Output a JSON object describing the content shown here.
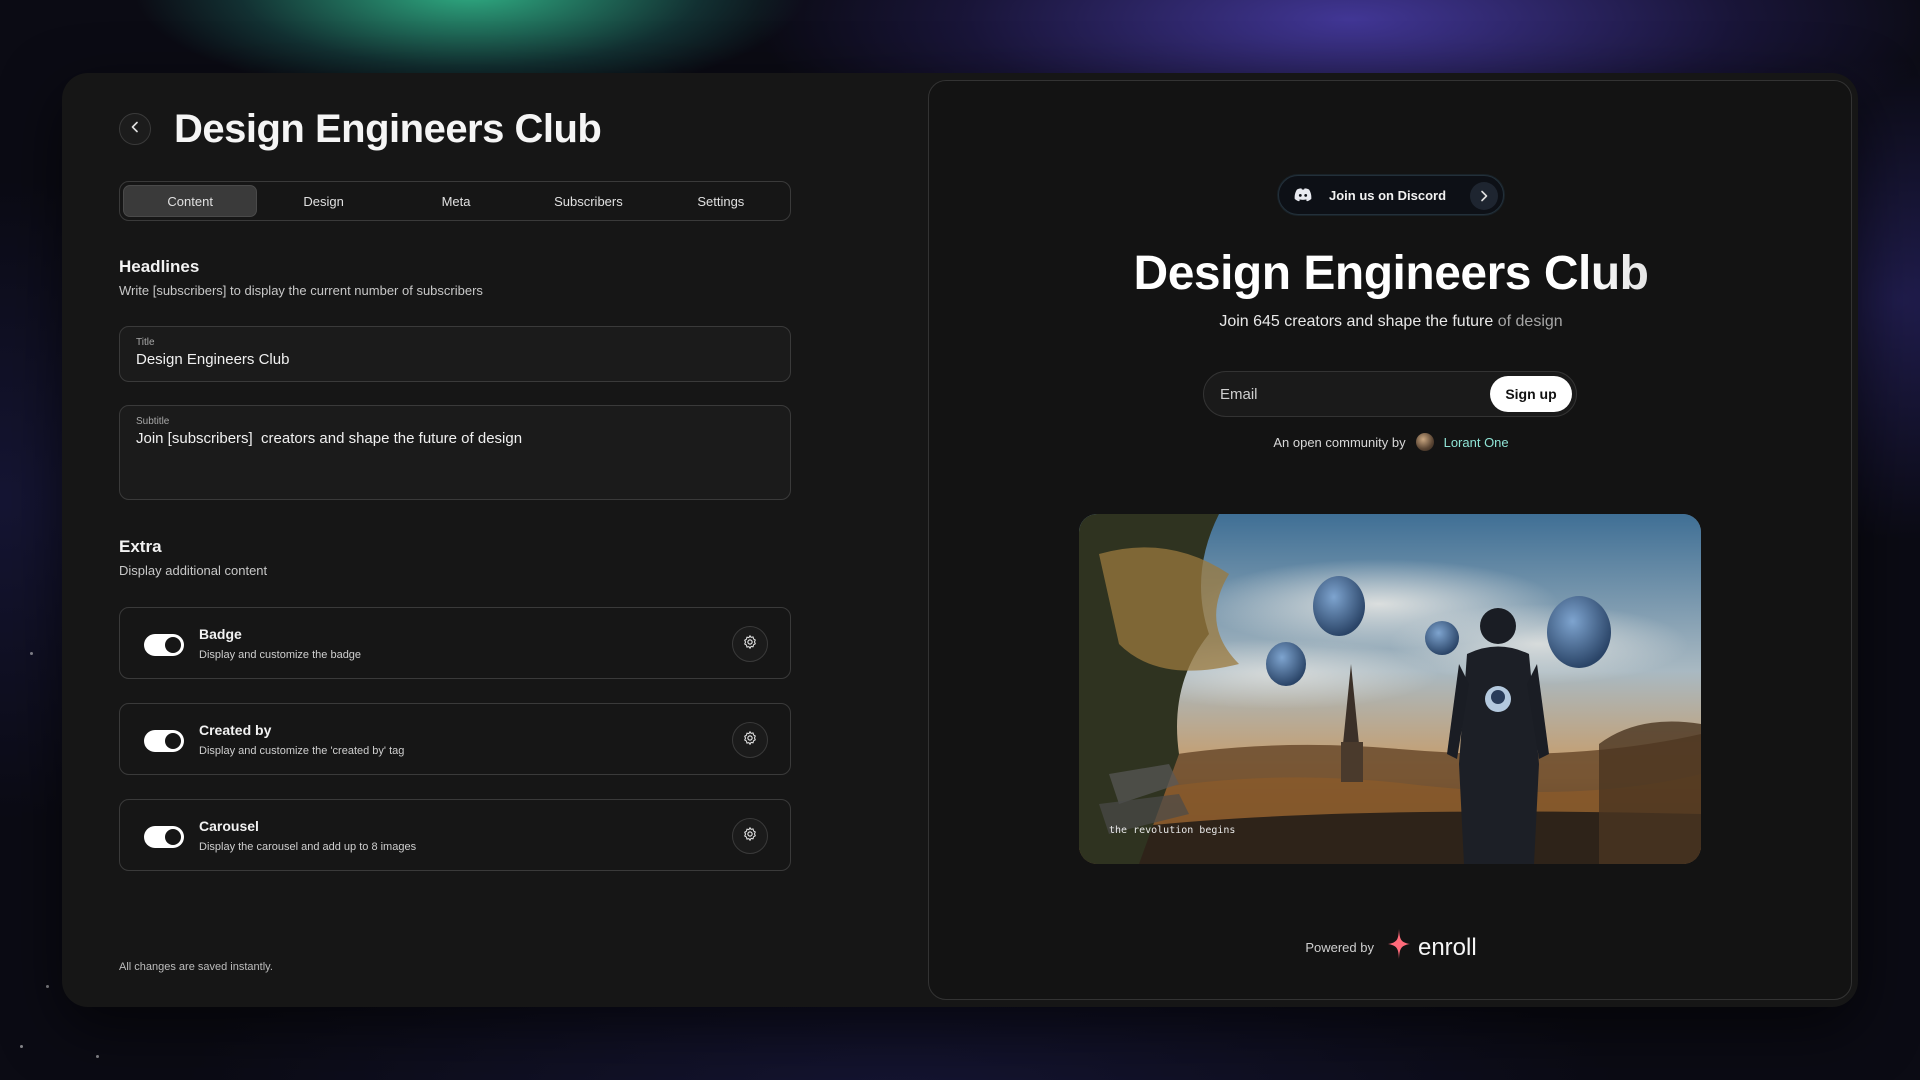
{
  "header": {
    "title": "Design Engineers Club",
    "back_icon": "chevron-left-icon"
  },
  "tabs": [
    {
      "label": "Content",
      "active": true
    },
    {
      "label": "Design",
      "active": false
    },
    {
      "label": "Meta",
      "active": false
    },
    {
      "label": "Subscribers",
      "active": false
    },
    {
      "label": "Settings",
      "active": false
    }
  ],
  "headlines": {
    "title": "Headlines",
    "description": "Write [subscribers] to display the current number of subscribers",
    "title_field": {
      "label": "Title",
      "value": "Design Engineers Club"
    },
    "subtitle_field": {
      "label": "Subtitle",
      "value": "Join [subscribers]  creators and shape the future of design"
    }
  },
  "extra": {
    "title": "Extra",
    "description": "Display additional content",
    "items": [
      {
        "title": "Badge",
        "description": "Display and customize the badge",
        "enabled": true
      },
      {
        "title": "Created by",
        "description": "Display and customize the 'created by' tag",
        "enabled": true
      },
      {
        "title": "Carousel",
        "description": "Display the carousel and add up to 8 images",
        "enabled": true
      }
    ]
  },
  "footer_note": "All changes are saved instantly.",
  "preview": {
    "badge": {
      "label": "Join us on Discord",
      "icon": "discord-icon"
    },
    "title": "Design Engineers Club",
    "subtitle_main": "Join 645 creators and shape the future",
    "subtitle_dim": " of design",
    "signup": {
      "placeholder": "Email",
      "button": "Sign up"
    },
    "community": {
      "prefix": "An open community by",
      "author": "Lorant One"
    },
    "image_caption": "the revolution begins",
    "powered_by": {
      "label": "Powered by",
      "brand": "enroll"
    }
  },
  "colors": {
    "accent_link": "#8fe3d5",
    "brand_spark": "#ff6b7a"
  }
}
